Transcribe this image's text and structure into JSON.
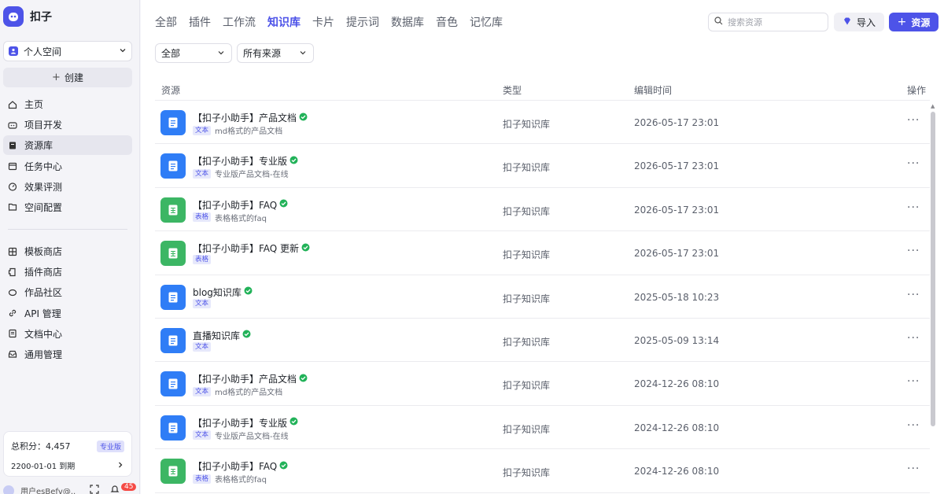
{
  "app": {
    "name": "扣子",
    "brand_color": "#4d53e8"
  },
  "sidebar": {
    "space": "个人空间",
    "create_label": "创建",
    "nav_main": [
      {
        "label": "主页",
        "icon": "home-icon",
        "active": false
      },
      {
        "label": "项目开发",
        "icon": "gamepad-icon",
        "active": false
      },
      {
        "label": "资源库",
        "icon": "book-icon",
        "active": true
      },
      {
        "label": "任务中心",
        "icon": "calendar-icon",
        "active": false
      },
      {
        "label": "效果评测",
        "icon": "gauge-icon",
        "active": false
      },
      {
        "label": "空间配置",
        "icon": "folder-settings-icon",
        "active": false
      }
    ],
    "nav_secondary": [
      {
        "label": "模板商店",
        "icon": "grid-icon"
      },
      {
        "label": "插件商店",
        "icon": "plugin-icon"
      },
      {
        "label": "作品社区",
        "icon": "community-icon"
      },
      {
        "label": "API 管理",
        "icon": "link-icon"
      },
      {
        "label": "文档中心",
        "icon": "document-icon"
      },
      {
        "label": "通用管理",
        "icon": "inbox-icon"
      }
    ],
    "points": {
      "label": "总积分：4,457",
      "badge": "专业版",
      "expire": "2200-01-01 到期"
    },
    "user": {
      "name": "用户esBefv@...",
      "notification_count": "45"
    }
  },
  "tabs": [
    {
      "label": "全部",
      "active": false
    },
    {
      "label": "插件",
      "active": false
    },
    {
      "label": "工作流",
      "active": false
    },
    {
      "label": "知识库",
      "active": true
    },
    {
      "label": "卡片",
      "active": false
    },
    {
      "label": "提示词",
      "active": false
    },
    {
      "label": "数据库",
      "active": false
    },
    {
      "label": "音色",
      "active": false
    },
    {
      "label": "记忆库",
      "active": false
    }
  ],
  "toolbar": {
    "search_placeholder": "搜索资源",
    "import_label": "导入",
    "resource_label": "资源"
  },
  "filters": {
    "type": "全部",
    "source": "所有来源"
  },
  "table": {
    "headers": {
      "resource": "资源",
      "type": "类型",
      "edit_time": "编辑时间",
      "actions": "操作"
    },
    "rows": [
      {
        "name": "【扣子小助手】产品文档",
        "tag": "文本",
        "desc": "md格式的产品文档",
        "type": "扣子知识库",
        "time": "2026-05-17 23:01",
        "kind": "doc"
      },
      {
        "name": "【扣子小助手】专业版",
        "tag": "文本",
        "desc": "专业版产品文档-在线",
        "type": "扣子知识库",
        "time": "2026-05-17 23:01",
        "kind": "doc"
      },
      {
        "name": "【扣子小助手】FAQ",
        "tag": "表格",
        "desc": "表格格式的faq",
        "type": "扣子知识库",
        "time": "2026-05-17 23:01",
        "kind": "sheet"
      },
      {
        "name": "【扣子小助手】FAQ 更新",
        "tag": "表格",
        "desc": "",
        "type": "扣子知识库",
        "time": "2026-05-17 23:01",
        "kind": "sheet"
      },
      {
        "name": "blog知识库",
        "tag": "文本",
        "desc": "",
        "type": "扣子知识库",
        "time": "2025-05-18 10:23",
        "kind": "doc"
      },
      {
        "name": "直播知识库",
        "tag": "文本",
        "desc": "",
        "type": "扣子知识库",
        "time": "2025-05-09 13:14",
        "kind": "doc"
      },
      {
        "name": "【扣子小助手】产品文档",
        "tag": "文本",
        "desc": "md格式的产品文档",
        "type": "扣子知识库",
        "time": "2024-12-26 08:10",
        "kind": "doc"
      },
      {
        "name": "【扣子小助手】专业版",
        "tag": "文本",
        "desc": "专业版产品文档-在线",
        "type": "扣子知识库",
        "time": "2024-12-26 08:10",
        "kind": "doc"
      },
      {
        "name": "【扣子小助手】FAQ",
        "tag": "表格",
        "desc": "表格格式的faq",
        "type": "扣子知识库",
        "time": "2024-12-26 08:10",
        "kind": "sheet"
      }
    ]
  }
}
